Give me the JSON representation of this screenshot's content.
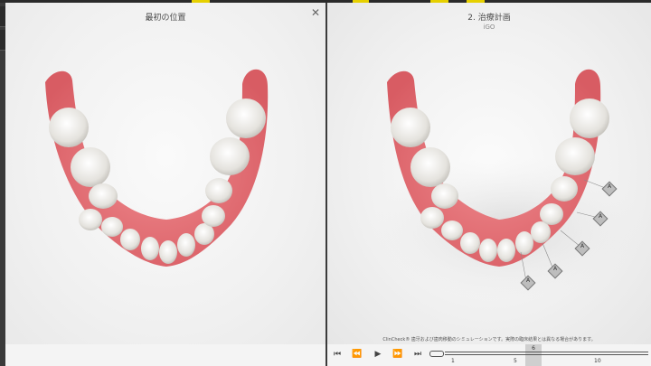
{
  "left_pane": {
    "title": "最初の位置",
    "close_icon": "close-icon"
  },
  "right_pane": {
    "title": "2. 治療計画",
    "subtitle": "iGO",
    "attachment_label": "A",
    "disclaimer": "ClinCheck® 歯牙および歯肉移動のシミュレーションです。実際の臨床結果とは異なる場合があります。"
  },
  "playback": {
    "icons": [
      "skip-to-start-icon",
      "step-back-icon",
      "play-icon",
      "step-forward-icon",
      "skip-to-end-icon"
    ],
    "glyphs": [
      "⏮",
      "⏪",
      "▶",
      "⏩",
      "⏭"
    ]
  },
  "timeline": {
    "labels": [
      "1",
      "5",
      "6",
      "10"
    ],
    "current_stage": "6"
  },
  "colors": {
    "accent": "#e6d000",
    "gum": "#e7747a",
    "tooth": "#f1f0ec"
  }
}
